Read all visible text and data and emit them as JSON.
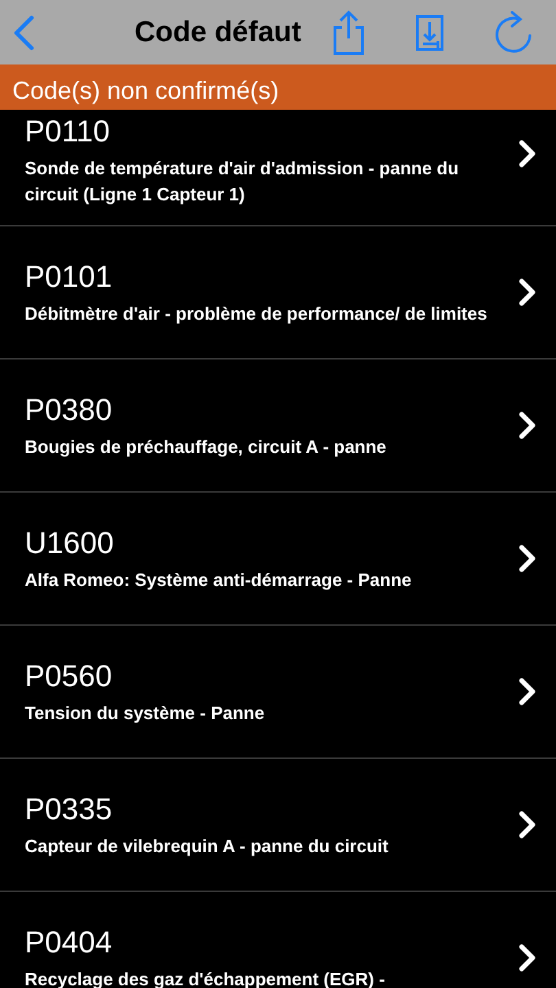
{
  "nav_bar": {
    "title": "Code défaut"
  },
  "section_header": "Code(s) non confirmé(s)",
  "codes": [
    {
      "code": "P0110",
      "description": "Sonde de température d'air d'admission - panne du circuit (Ligne 1 Capteur 1)"
    },
    {
      "code": "P0101",
      "description": "Débitmètre d'air - problème de performance/ de limites"
    },
    {
      "code": "P0380",
      "description": "Bougies de préchauffage, circuit A - panne"
    },
    {
      "code": "U1600",
      "description": "Alfa Romeo: Système anti-démarrage - Panne"
    },
    {
      "code": "P0560",
      "description": "Tension du système - Panne"
    },
    {
      "code": "P0335",
      "description": "Capteur de vilebrequin A - panne du circuit"
    },
    {
      "code": "P0404",
      "description": "Recyclage des gaz d'échappement (EGR) -"
    }
  ]
}
